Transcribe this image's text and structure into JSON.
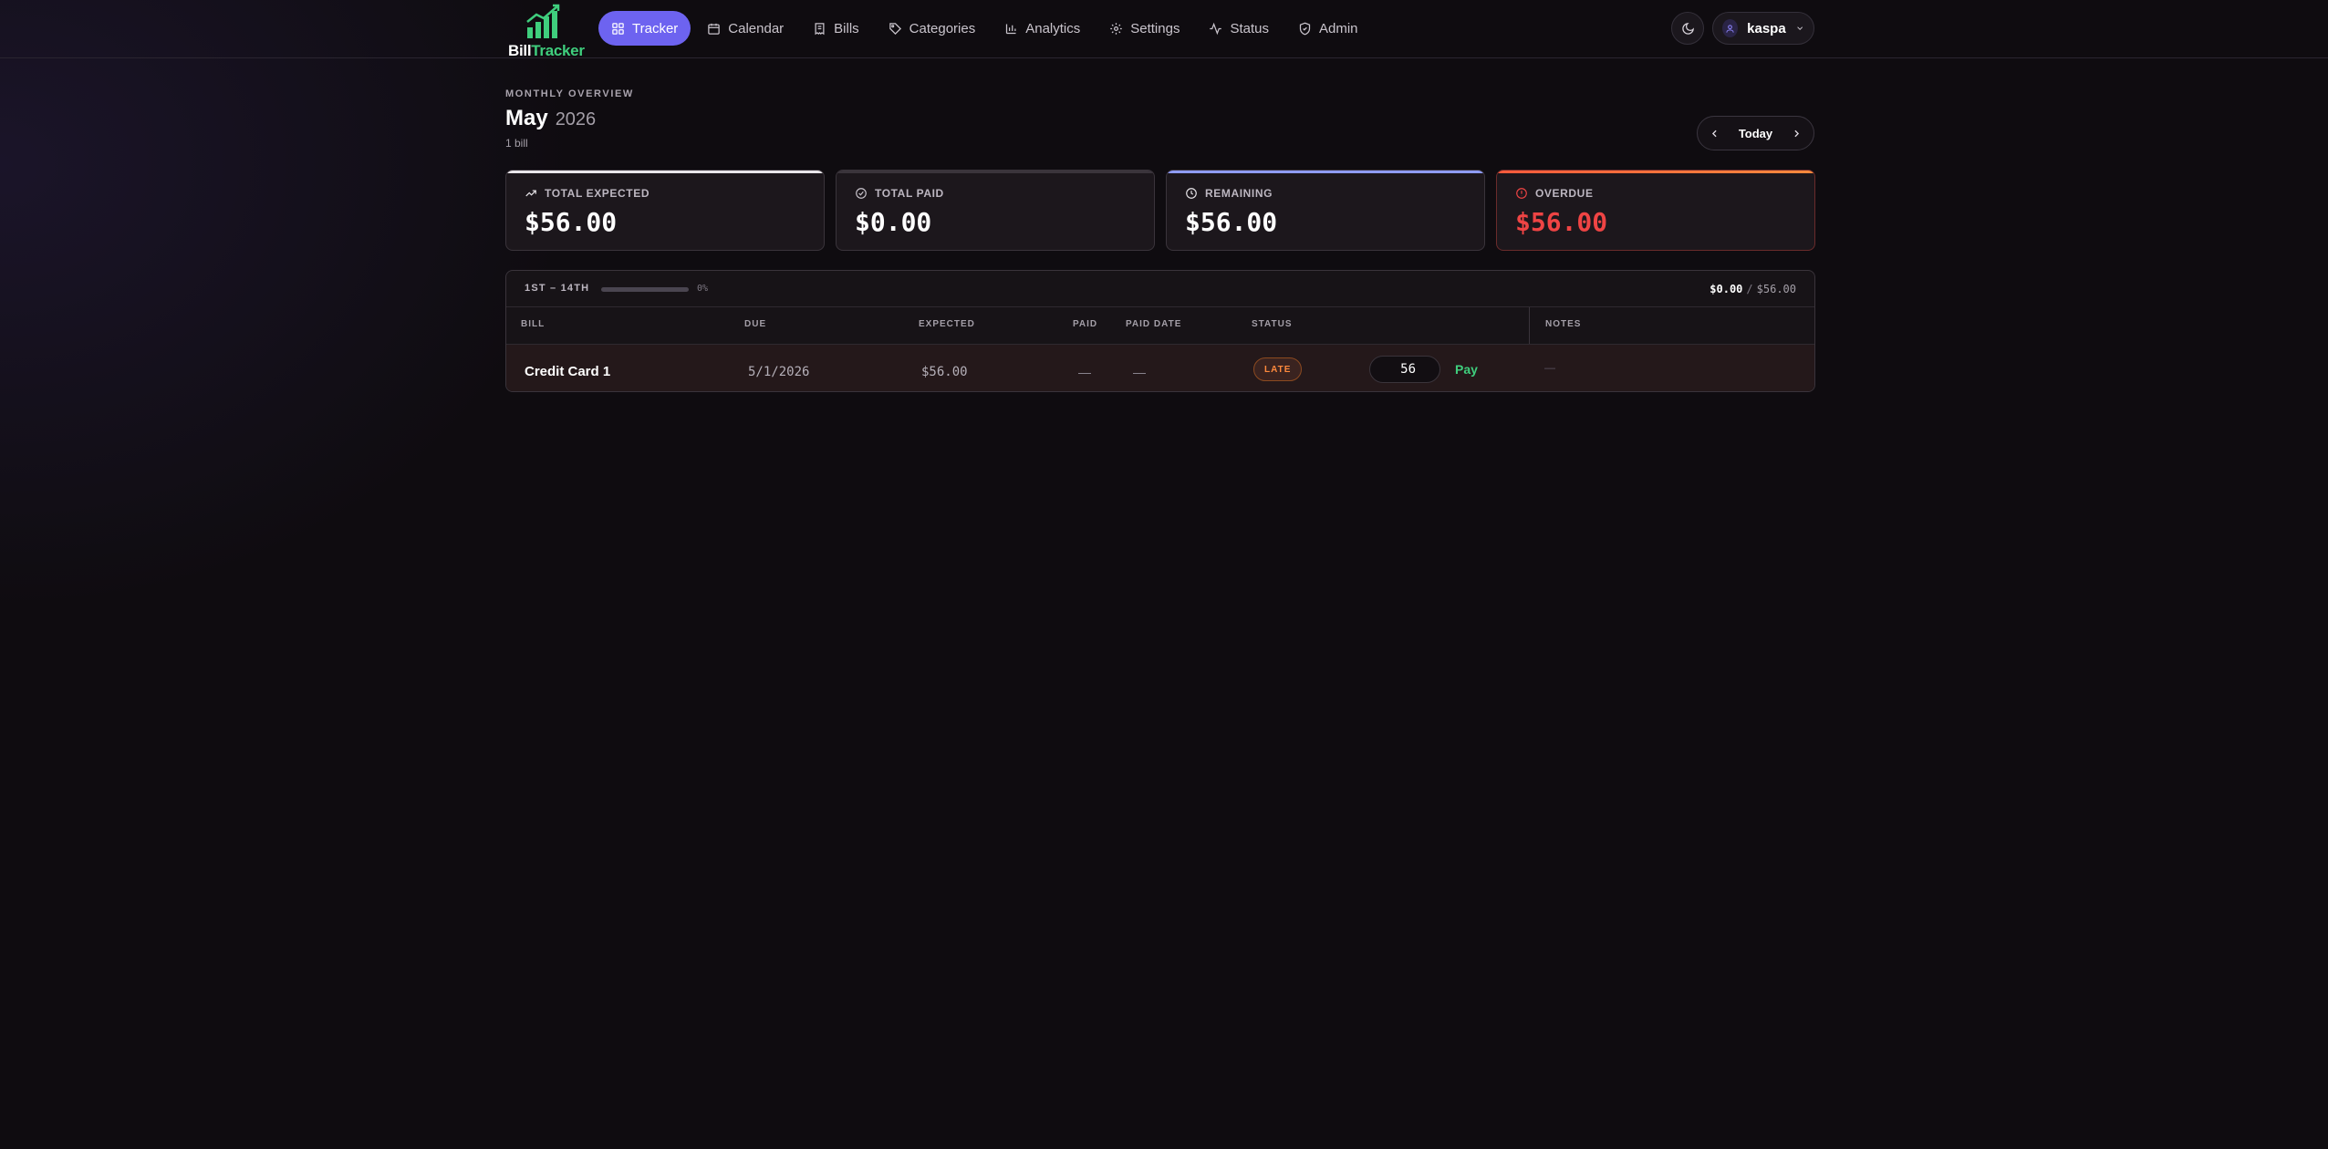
{
  "brand": {
    "name_part1": "Bill",
    "name_part2": "Tracker"
  },
  "nav": {
    "items": [
      {
        "label": "Tracker",
        "icon": "grid-icon",
        "active": true
      },
      {
        "label": "Calendar",
        "icon": "calendar-icon"
      },
      {
        "label": "Bills",
        "icon": "receipt-icon"
      },
      {
        "label": "Categories",
        "icon": "tag-icon"
      },
      {
        "label": "Analytics",
        "icon": "bar-chart-icon"
      },
      {
        "label": "Settings",
        "icon": "gear-icon"
      },
      {
        "label": "Status",
        "icon": "activity-icon"
      },
      {
        "label": "Admin",
        "icon": "shield-icon"
      }
    ]
  },
  "user": {
    "name": "kaspa",
    "icon": "user-icon"
  },
  "header": {
    "overline": "MONTHLY OVERVIEW",
    "month": "May",
    "year": "2026",
    "subtitle": "1 bill",
    "today_label": "Today"
  },
  "cards": [
    {
      "label": "TOTAL EXPECTED",
      "value": "$56.00",
      "icon": "trending-up-icon",
      "accent": "#e9e6ea"
    },
    {
      "label": "TOTAL PAID",
      "value": "$0.00",
      "icon": "check-circle-icon",
      "accent": "#3a343b"
    },
    {
      "label": "REMAINING",
      "value": "$56.00",
      "icon": "clock-icon",
      "accent": "#8f9cff"
    },
    {
      "label": "OVERDUE",
      "value": "$56.00",
      "icon": "alert-circle-icon",
      "accent": "#ff5a3c",
      "value_color": "#ef4444"
    }
  ],
  "period": {
    "label": "1ST – 14TH",
    "progress_pct": 0,
    "progress_text": "0%",
    "paid_total": "$0.00",
    "separator": "/",
    "expected_total": "$56.00"
  },
  "table": {
    "headers": {
      "bill": "BILL",
      "due": "DUE",
      "expected": "EXPECTED",
      "paid": "PAID",
      "paid_date": "PAID DATE",
      "status": "STATUS",
      "notes": "NOTES"
    },
    "rows": [
      {
        "bill": "Credit Card 1",
        "due": "5/1/2026",
        "expected": "$56.00",
        "paid": "—",
        "paid_date": "—",
        "status": "LATE",
        "amount_input": "56",
        "pay_label": "Pay",
        "notes": "—"
      }
    ]
  },
  "colors": {
    "accent": "#6d63f0",
    "success": "#3fce7d",
    "danger": "#ef4444",
    "warning": "#ff8a3d"
  }
}
